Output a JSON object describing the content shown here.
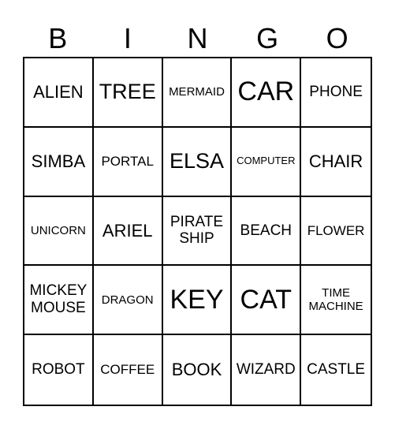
{
  "header": [
    "B",
    "I",
    "N",
    "G",
    "O"
  ],
  "cells": [
    {
      "text": "ALIEN",
      "size": "s-m"
    },
    {
      "text": "TREE",
      "size": "s-l"
    },
    {
      "text": "MERMAID",
      "size": "s-xs"
    },
    {
      "text": "CAR",
      "size": "s-xl"
    },
    {
      "text": "PHONE",
      "size": "s-ms"
    },
    {
      "text": "SIMBA",
      "size": "s-m"
    },
    {
      "text": "PORTAL",
      "size": "s-s"
    },
    {
      "text": "ELSA",
      "size": "s-l"
    },
    {
      "text": "COMPUTER",
      "size": "s-xxs"
    },
    {
      "text": "CHAIR",
      "size": "s-m"
    },
    {
      "text": "UNICORN",
      "size": "s-xs"
    },
    {
      "text": "ARIEL",
      "size": "s-m"
    },
    {
      "text": "PIRATE SHIP",
      "size": "s-ms"
    },
    {
      "text": "BEACH",
      "size": "s-ms"
    },
    {
      "text": "FLOWER",
      "size": "s-s"
    },
    {
      "text": "MICKEY MOUSE",
      "size": "s-ms"
    },
    {
      "text": "DRAGON",
      "size": "s-xs"
    },
    {
      "text": "KEY",
      "size": "s-xl"
    },
    {
      "text": "CAT",
      "size": "s-xl"
    },
    {
      "text": "TIME MACHINE",
      "size": "s-xs"
    },
    {
      "text": "ROBOT",
      "size": "s-ms"
    },
    {
      "text": "COFFEE",
      "size": "s-s"
    },
    {
      "text": "BOOK",
      "size": "s-m"
    },
    {
      "text": "WIZARD",
      "size": "s-ms"
    },
    {
      "text": "CASTLE",
      "size": "s-ms"
    }
  ]
}
